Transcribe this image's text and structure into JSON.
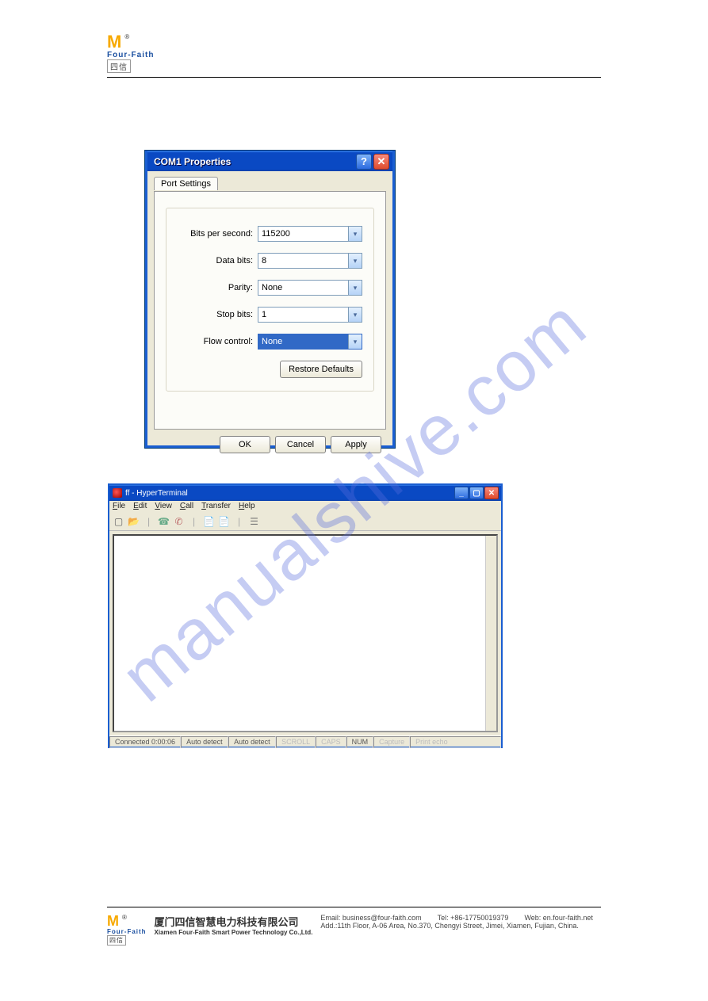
{
  "header": {
    "brand": "Four-Faith",
    "cn_symbol": "四信"
  },
  "watermark": "manualshive.com",
  "dialog1": {
    "title": "COM1 Properties",
    "tab_label": "Port Settings",
    "fields": {
      "bps": {
        "label": "Bits per second:",
        "value": "115200"
      },
      "databits": {
        "label": "Data bits:",
        "value": "8"
      },
      "parity": {
        "label": "Parity:",
        "value": "None"
      },
      "stopbits": {
        "label": "Stop bits:",
        "value": "1"
      },
      "flow": {
        "label": "Flow control:",
        "value": "None"
      }
    },
    "restore_label": "Restore Defaults",
    "ok_label": "OK",
    "cancel_label": "Cancel",
    "apply_label": "Apply"
  },
  "window2": {
    "title": "ff - HyperTerminal",
    "menu": {
      "file": "File",
      "edit": "Edit",
      "view": "View",
      "call": "Call",
      "transfer": "Transfer",
      "help": "Help"
    },
    "status": {
      "connected": "Connected 0:00:06",
      "detect1": "Auto detect",
      "detect2": "Auto detect",
      "scroll": "SCROLL",
      "caps": "CAPS",
      "num": "NUM",
      "capture": "Capture",
      "printecho": "Print echo"
    }
  },
  "footer": {
    "company_cn": "厦门四信智慧电力科技有限公司",
    "company_en": "Xiamen Four-Faith Smart Power Technology Co.,Ltd.",
    "email_label": "Email: business@four-faith.com",
    "tel_label": "Tel: +86-17750019379",
    "web_label": "Web: en.four-faith.net",
    "addr_label": "Add.:11th Floor, A-06 Area, No.370, Chengyi Street, Jimei, Xiamen, Fujian, China."
  }
}
